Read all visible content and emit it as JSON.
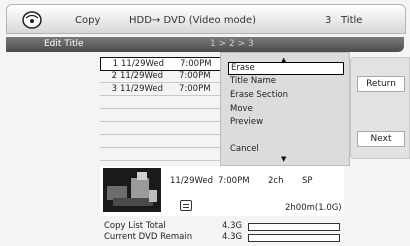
{
  "header": {
    "app": "Copy",
    "mode": "HDD→ DVD (Video mode)",
    "count": "3",
    "count_label": "Title"
  },
  "subbar": {
    "label": "Edit Title",
    "page_indicator": "1 > 2 > 3"
  },
  "titles": [
    {
      "num": "1",
      "date": "11/29Wed",
      "time": "7:00PM"
    },
    {
      "num": "2",
      "date": "11/29Wed",
      "time": "7:00PM"
    },
    {
      "num": "3",
      "date": "11/29Wed",
      "time": "7:00PM"
    }
  ],
  "menu": {
    "items": [
      "Erase",
      "Title Name",
      "Erase Section",
      "Move",
      "Preview",
      "Cancel"
    ],
    "up_icon": "up-arrow-icon",
    "down_icon": "down-arrow-icon"
  },
  "buttons": {
    "return": "Return",
    "next": "Next"
  },
  "preview": {
    "date": "11/29Wed",
    "time": "7:00PM",
    "channel": "2ch",
    "quality": "SP",
    "duration": "2h00m(1.0G)"
  },
  "status": {
    "copy_list_label": "Copy List Total",
    "copy_list_value": "4.3G",
    "dvd_remain_label": "Current DVD Remain",
    "dvd_remain_value": "4.3G"
  }
}
